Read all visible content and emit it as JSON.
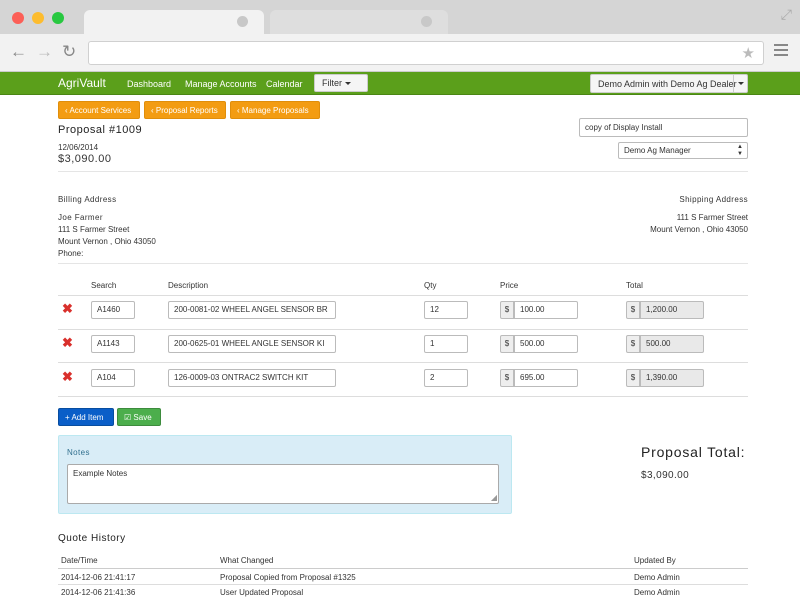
{
  "app": {
    "brand": "AgriVault",
    "nav": [
      "Dashboard",
      "Manage Accounts",
      "Calendar"
    ],
    "filter_label": "Filter",
    "user_label": "Demo Admin with Demo Ag Dealer"
  },
  "breadcrumbs": [
    "Account Services",
    "Proposal Reports",
    "Manage Proposals"
  ],
  "proposal": {
    "title": "Proposal #1009",
    "date": "12/06/2014",
    "amount": "$3,090.00",
    "name_value": "copy of Display Install",
    "manager_value": "Demo Ag Manager"
  },
  "billing": {
    "heading": "Billing Address",
    "name": "Joe Farmer",
    "street": "111 S Farmer Street",
    "city": "Mount Vernon , Ohio 43050",
    "phone": "Phone:"
  },
  "shipping": {
    "heading": "Shipping Address",
    "street": "111 S Farmer Street",
    "city": "Mount Vernon , Ohio 43050"
  },
  "items_table": {
    "headers": [
      "Search",
      "Description",
      "Qty",
      "Price",
      "Total"
    ],
    "currency": "$",
    "rows": [
      {
        "search": "A1460",
        "description": "200-0081-02 WHEEL ANGEL SENSOR BR",
        "qty": "12",
        "price": "100.00",
        "total": "1,200.00"
      },
      {
        "search": "A1143",
        "description": "200-0625-01 WHEEL ANGLE SENSOR KI",
        "qty": "1",
        "price": "500.00",
        "total": "500.00"
      },
      {
        "search": "A104",
        "description": "126-0009-03 ONTRAC2 SWITCH KIT",
        "qty": "2",
        "price": "695.00",
        "total": "1,390.00"
      }
    ]
  },
  "actions": {
    "add_item": "Add Item",
    "save": "Save"
  },
  "notes": {
    "label": "Notes",
    "value": "Example Notes"
  },
  "summary": {
    "total_label": "Proposal Total:",
    "total_value": "$3,090.00"
  },
  "quote_history": {
    "title": "Quote History",
    "headers": [
      "Date/Time",
      "What Changed",
      "Updated By"
    ],
    "rows": [
      {
        "datetime": "2014-12-06 21:41:17",
        "change": "Proposal Copied from Proposal #1325",
        "by": "Demo Admin"
      },
      {
        "datetime": "2014-12-06 21:41:36",
        "change": "User Updated Proposal",
        "by": "Demo Admin"
      }
    ]
  },
  "colors": {
    "navbar": "#5b9f1b",
    "orange": "#f39c12",
    "blue": "#0a5ec8",
    "green": "#4cae4c",
    "danger": "#d9302c"
  }
}
